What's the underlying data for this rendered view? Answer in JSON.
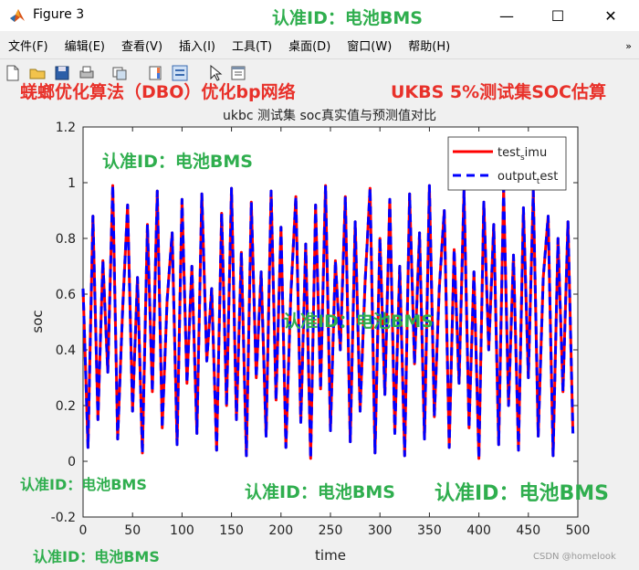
{
  "window": {
    "title": "Figure 3",
    "minimize_glyph": "—",
    "maximize_glyph": "☐",
    "close_glyph": "✕"
  },
  "menu": [
    "文件(F)",
    "编辑(E)",
    "查看(V)",
    "插入(I)",
    "工具(T)",
    "桌面(D)",
    "窗口(W)",
    "帮助(H)"
  ],
  "menu_overflow_glyph": "»",
  "toolbar": {
    "icons": [
      "new-file-icon",
      "open-folder-icon",
      "save-icon",
      "print-icon",
      "link-plot-icon",
      "colorbar-icon",
      "legend-icon",
      "pointer-icon",
      "property-editor-icon"
    ]
  },
  "overlay_text": {
    "top_center": "认准ID：电池BMS",
    "left_banner": "蜣螂优化算法（DBO）优化bp网络",
    "right_banner": "UKBS 5%测试集SOC估算",
    "plot_upper_left": "认准ID：电池BMS",
    "plot_center": "认准ID：电池BMS",
    "bottom_left_1": "认准ID：电池BMS",
    "bottom_center": "认准ID：电池BMS",
    "bottom_right": "认准ID：电池BMS",
    "bottom_left_2": "认准ID：电池BMS",
    "csdn": "CSDN @homelook"
  },
  "colors": {
    "red_text": "#e8312a",
    "green_text": "#2fae4e",
    "series_red": "#ff0000",
    "series_blue": "#0000ff"
  },
  "chart_data": {
    "type": "line",
    "title": "ukbc 测试集 soc真实值与预测值对比",
    "xlabel": "time",
    "ylabel": "soc",
    "xlim": [
      0,
      500
    ],
    "ylim": [
      -0.2,
      1.2
    ],
    "xticks": [
      0,
      50,
      100,
      150,
      200,
      250,
      300,
      350,
      400,
      450,
      500
    ],
    "yticks": [
      -0.2,
      0,
      0.2,
      0.4,
      0.6,
      0.8,
      1,
      1.2
    ],
    "grid": false,
    "legend": "top-right",
    "series": [
      {
        "name": "test_simu",
        "style": "solid",
        "color": "#ff0000"
      },
      {
        "name": "output_test",
        "style": "dashed",
        "color": "#0000ff"
      }
    ],
    "legend_labels": [
      {
        "base": "test",
        "sub": "s",
        "rest": "imu"
      },
      {
        "base": "output",
        "sub": "t",
        "rest": "est"
      }
    ],
    "x": [
      0,
      5,
      10,
      15,
      20,
      25,
      30,
      35,
      40,
      45,
      50,
      55,
      60,
      65,
      70,
      75,
      80,
      85,
      90,
      95,
      100,
      105,
      110,
      115,
      120,
      125,
      130,
      135,
      140,
      145,
      150,
      155,
      160,
      165,
      170,
      175,
      180,
      185,
      190,
      195,
      200,
      205,
      210,
      215,
      220,
      225,
      230,
      235,
      240,
      245,
      250,
      255,
      260,
      265,
      270,
      275,
      280,
      285,
      290,
      295,
      300,
      305,
      310,
      315,
      320,
      325,
      330,
      335,
      340,
      345,
      350,
      355,
      360,
      365,
      370,
      375,
      380,
      385,
      390,
      395,
      400,
      405,
      410,
      415,
      420,
      425,
      430,
      435,
      440,
      445,
      450,
      455,
      460,
      465,
      470,
      475,
      480,
      485,
      490,
      495
    ],
    "values": [
      0.62,
      0.05,
      0.88,
      0.15,
      0.72,
      0.32,
      0.99,
      0.08,
      0.55,
      0.92,
      0.18,
      0.66,
      0.03,
      0.85,
      0.25,
      0.97,
      0.12,
      0.58,
      0.82,
      0.06,
      0.94,
      0.28,
      0.7,
      0.1,
      0.96,
      0.36,
      0.62,
      0.04,
      0.89,
      0.2,
      0.98,
      0.15,
      0.75,
      0.02,
      0.93,
      0.3,
      0.68,
      0.09,
      0.97,
      0.22,
      0.84,
      0.05,
      0.6,
      0.95,
      0.14,
      0.78,
      0.01,
      0.92,
      0.26,
      0.99,
      0.11,
      0.72,
      0.4,
      0.95,
      0.07,
      0.86,
      0.18,
      0.64,
      0.98,
      0.03,
      0.8,
      0.24,
      0.94,
      0.1,
      0.7,
      0.02,
      0.96,
      0.35,
      0.82,
      0.08,
      0.99,
      0.16,
      0.62,
      0.9,
      0.05,
      0.76,
      0.28,
      0.97,
      0.12,
      0.68,
      0.01,
      0.93,
      0.4,
      0.85,
      0.06,
      0.98,
      0.2,
      0.74,
      0.04,
      0.91,
      0.3,
      0.97,
      0.09,
      0.66,
      0.88,
      0.02,
      0.8,
      0.25,
      0.86,
      0.1
    ]
  }
}
